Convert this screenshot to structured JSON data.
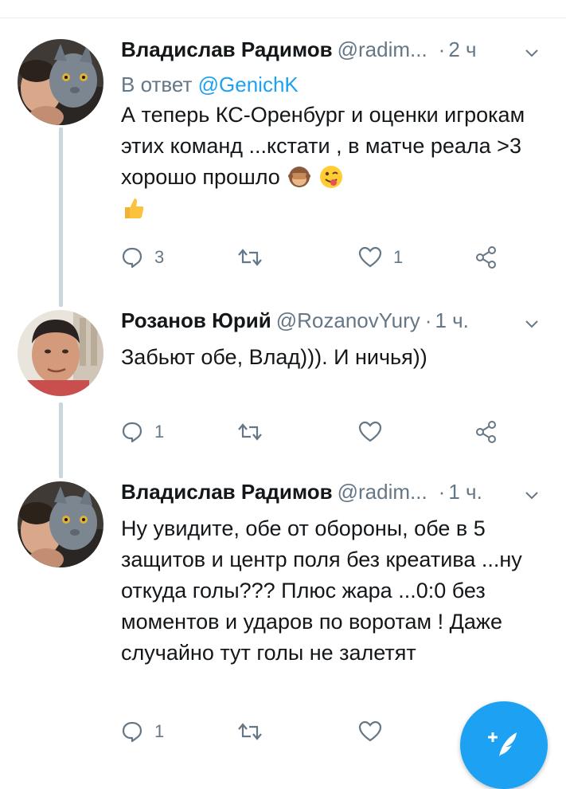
{
  "tweets": [
    {
      "author": "Владислав Радимов",
      "handle": "@radim...",
      "separator": "·",
      "time": "2 ч",
      "reply_label": "В ответ",
      "reply_mention": "@GenichK",
      "text": "А теперь КС-Оренбург и оценки игрокам этих команд ...кстати , в матче реала >3 хорошо прошло",
      "emojis": [
        "see-no-evil-monkey",
        "winking-tongue-face",
        "thumbs-up"
      ],
      "replies": "3",
      "retweets": "",
      "likes": "1"
    },
    {
      "author": "Розанов Юрий",
      "handle": "@RozanovYury",
      "separator": "·",
      "time": "1 ч.",
      "text": "Забьют обе, Влад))). И ничья))",
      "replies": "1",
      "retweets": "",
      "likes": ""
    },
    {
      "author": "Владислав Радимов",
      "handle": "@radim...",
      "separator": "·",
      "time": "1 ч.",
      "text": "Ну увидите, обе от обороны, обе в 5 защитов и центр поля без креатива ...ну откуда голы??? Плюс жара ...0:0 без моментов и ударов по воротам ! Даже случайно тут голы не залетят",
      "replies": "1",
      "retweets": "",
      "likes": ""
    }
  ],
  "icons": {
    "reply": "reply-icon",
    "retweet": "retweet-icon",
    "like": "heart-icon",
    "share": "share-icon",
    "caret": "chevron-down-icon",
    "compose": "compose-tweet-icon"
  },
  "colors": {
    "accent": "#1da1f2",
    "secondary_text": "#657786",
    "thread_line": "#ccd6dd",
    "icon": "#657786"
  }
}
